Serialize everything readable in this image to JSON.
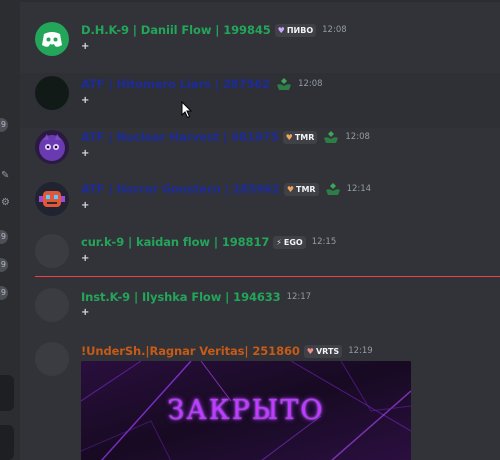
{
  "colors": {
    "chat_bg": "#313338",
    "rail_bg": "#2b2d31",
    "green_name": "#23a55a",
    "dark_blue_name": "#1c2b9a",
    "orange_name": "#c75a17",
    "new_divider": "#f23f43",
    "timestamp": "#949ba4"
  },
  "rail": {
    "badges": [
      "9",
      "9",
      "9",
      "9",
      "9"
    ]
  },
  "messages": [
    {
      "name": "D.H.K-9 | Daniil Flow | 199845",
      "tag_icon": "heart-icon",
      "tag_label": "ПИВО",
      "server_icon": "",
      "time": "12:08",
      "content": "+"
    },
    {
      "name": "ATF | Hitomaro Liars | 287562",
      "tag_icon": "",
      "tag_label": "",
      "server_icon": "green-emblem-icon",
      "time": "12:08",
      "content": "+"
    },
    {
      "name": "ATF | Nuclear Harvest | 681975",
      "tag_icon": "heart-icon",
      "tag_label": "TMR",
      "server_icon": "green-emblem-icon",
      "time": "12:08",
      "content": "+"
    },
    {
      "name": "ATF | Horror Gonstero | 285962",
      "tag_icon": "heart-icon",
      "tag_label": "TMR",
      "server_icon": "green-emblem-icon",
      "time": "12:14",
      "content": "+"
    },
    {
      "name": "cur.k-9 | kaidan flow | 198817",
      "tag_icon": "lightning-icon",
      "tag_label": "EGO",
      "server_icon": "",
      "time": "12:15",
      "content": "+"
    },
    {
      "name": "Inst.K-9 | Ilyshka Flow | 194633",
      "tag_icon": "",
      "tag_label": "",
      "server_icon": "",
      "time": "12:17",
      "content": "+"
    },
    {
      "name": "!UnderSh.|Ragnar Veritas| 251860",
      "tag_icon": "heart-icon",
      "tag_label": "VRTS",
      "server_icon": "",
      "time": "12:19",
      "content": ""
    }
  ],
  "banner": {
    "text": "ЗАКРЫТО"
  }
}
